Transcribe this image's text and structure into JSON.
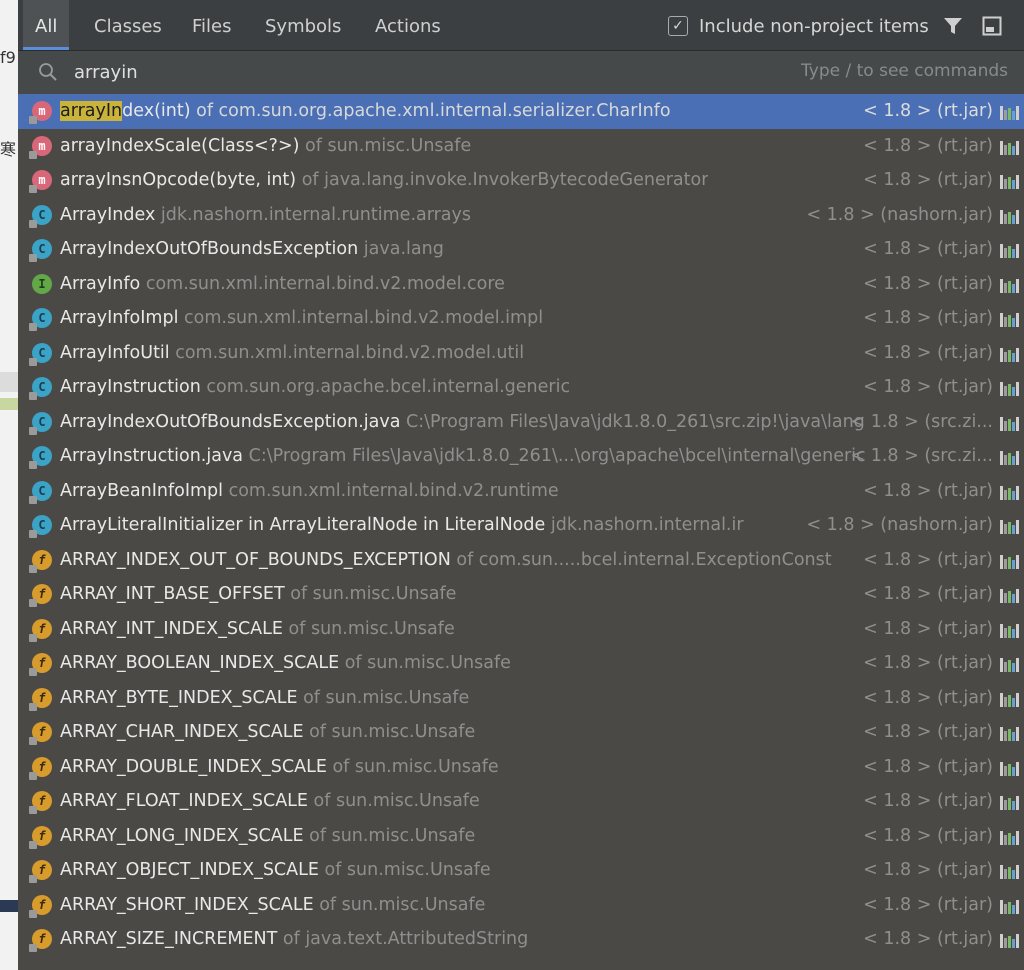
{
  "background": {
    "fragments": [
      "f9",
      "寒"
    ]
  },
  "tabs": [
    {
      "label": "All",
      "active": true
    },
    {
      "label": "Classes",
      "active": false
    },
    {
      "label": "Files",
      "active": false
    },
    {
      "label": "Symbols",
      "active": false
    },
    {
      "label": "Actions",
      "active": false
    }
  ],
  "header": {
    "include_checked": true,
    "include_label": "Include non-project items",
    "filter_icon": "filter-icon",
    "pin_icon": "pin-window-icon"
  },
  "search": {
    "value": "arrayin",
    "hint": "Type / to see commands"
  },
  "results": [
    {
      "icon": "m",
      "prefix": "",
      "highlight": "arrayIn",
      "name": "dex(int)",
      "context": " of com.sun.org.apache.xml.internal.serializer.CharInfo",
      "lib": "< 1.8 > (rt.jar)",
      "selected": true
    },
    {
      "icon": "m",
      "prefix": "",
      "highlight": "",
      "name": "arrayIndexScale(Class<?>)",
      "context": " of sun.misc.Unsafe",
      "lib": "< 1.8 > (rt.jar)"
    },
    {
      "icon": "m",
      "prefix": "",
      "highlight": "",
      "name": "arrayInsnOpcode(byte, int)",
      "context": " of java.lang.invoke.InvokerBytecodeGenerator",
      "lib": "< 1.8 > (rt.jar)"
    },
    {
      "icon": "c",
      "prefix": "",
      "highlight": "",
      "name": "ArrayIndex",
      "context": " jdk.nashorn.internal.runtime.arrays",
      "lib": "< 1.8 > (nashorn.jar)"
    },
    {
      "icon": "c",
      "prefix": "",
      "highlight": "",
      "name": "ArrayIndexOutOfBoundsException",
      "context": " java.lang",
      "lib": "< 1.8 > (rt.jar)"
    },
    {
      "icon": "i",
      "prefix": "",
      "highlight": "",
      "name": "ArrayInfo",
      "context": " com.sun.xml.internal.bind.v2.model.core",
      "lib": "< 1.8 > (rt.jar)"
    },
    {
      "icon": "c",
      "prefix": "",
      "highlight": "",
      "name": "ArrayInfoImpl",
      "context": " com.sun.xml.internal.bind.v2.model.impl",
      "lib": "< 1.8 > (rt.jar)"
    },
    {
      "icon": "c",
      "prefix": "",
      "highlight": "",
      "name": "ArrayInfoUtil",
      "context": " com.sun.xml.internal.bind.v2.model.util",
      "lib": "< 1.8 > (rt.jar)"
    },
    {
      "icon": "c",
      "prefix": "",
      "highlight": "",
      "name": "ArrayInstruction",
      "context": " com.sun.org.apache.bcel.internal.generic",
      "lib": "< 1.8 > (rt.jar)"
    },
    {
      "icon": "c",
      "prefix": "",
      "highlight": "",
      "name": "ArrayIndexOutOfBoundsException.java",
      "context": " C:\\Program Files\\Java\\jdk1.8.0_261\\src.zip!\\java\\lang",
      "lib": "< 1.8 > (src.zi..."
    },
    {
      "icon": "c",
      "prefix": "",
      "highlight": "",
      "name": "ArrayInstruction.java",
      "context": " C:\\Program Files\\Java\\jdk1.8.0_261\\...\\org\\apache\\bcel\\internal\\generic",
      "lib": "< 1.8 > (src.zi..."
    },
    {
      "icon": "c",
      "prefix": "",
      "highlight": "",
      "name": "ArrayBeanInfoImpl",
      "context": " com.sun.xml.internal.bind.v2.runtime",
      "lib": "< 1.8 > (rt.jar)"
    },
    {
      "icon": "c",
      "prefix": "",
      "highlight": "",
      "name": "ArrayLiteralInitializer in ArrayLiteralNode in LiteralNode",
      "context": " jdk.nashorn.internal.ir",
      "lib": "< 1.8 > (nashorn.jar)"
    },
    {
      "icon": "f",
      "prefix": "",
      "highlight": "",
      "name": "ARRAY_INDEX_OUT_OF_BOUNDS_EXCEPTION",
      "context": " of com.sun.....bcel.internal.ExceptionConst",
      "lib": "< 1.8 > (rt.jar)"
    },
    {
      "icon": "f",
      "prefix": "",
      "highlight": "",
      "name": "ARRAY_INT_BASE_OFFSET",
      "context": " of sun.misc.Unsafe",
      "lib": "< 1.8 > (rt.jar)"
    },
    {
      "icon": "f",
      "prefix": "",
      "highlight": "",
      "name": "ARRAY_INT_INDEX_SCALE",
      "context": " of sun.misc.Unsafe",
      "lib": "< 1.8 > (rt.jar)"
    },
    {
      "icon": "f",
      "prefix": "",
      "highlight": "",
      "name": "ARRAY_BOOLEAN_INDEX_SCALE",
      "context": " of sun.misc.Unsafe",
      "lib": "< 1.8 > (rt.jar)"
    },
    {
      "icon": "f",
      "prefix": "",
      "highlight": "",
      "name": "ARRAY_BYTE_INDEX_SCALE",
      "context": " of sun.misc.Unsafe",
      "lib": "< 1.8 > (rt.jar)"
    },
    {
      "icon": "f",
      "prefix": "",
      "highlight": "",
      "name": "ARRAY_CHAR_INDEX_SCALE",
      "context": " of sun.misc.Unsafe",
      "lib": "< 1.8 > (rt.jar)"
    },
    {
      "icon": "f",
      "prefix": "",
      "highlight": "",
      "name": "ARRAY_DOUBLE_INDEX_SCALE",
      "context": " of sun.misc.Unsafe",
      "lib": "< 1.8 > (rt.jar)"
    },
    {
      "icon": "f",
      "prefix": "",
      "highlight": "",
      "name": "ARRAY_FLOAT_INDEX_SCALE",
      "context": " of sun.misc.Unsafe",
      "lib": "< 1.8 > (rt.jar)"
    },
    {
      "icon": "f",
      "prefix": "",
      "highlight": "",
      "name": "ARRAY_LONG_INDEX_SCALE",
      "context": " of sun.misc.Unsafe",
      "lib": "< 1.8 > (rt.jar)"
    },
    {
      "icon": "f",
      "prefix": "",
      "highlight": "",
      "name": "ARRAY_OBJECT_INDEX_SCALE",
      "context": " of sun.misc.Unsafe",
      "lib": "< 1.8 > (rt.jar)"
    },
    {
      "icon": "f",
      "prefix": "",
      "highlight": "",
      "name": "ARRAY_SHORT_INDEX_SCALE",
      "context": " of sun.misc.Unsafe",
      "lib": "< 1.8 > (rt.jar)"
    },
    {
      "icon": "f",
      "prefix": "",
      "highlight": "",
      "name": "ARRAY_SIZE_INCREMENT",
      "context": " of java.text.AttributedString",
      "lib": "< 1.8 > (rt.jar)"
    }
  ],
  "colors": {
    "popup_bg": "#4b4945",
    "selection": "#4a6fb5",
    "highlight": "#c9b33a",
    "accent_tab": "#5a8ed8"
  }
}
